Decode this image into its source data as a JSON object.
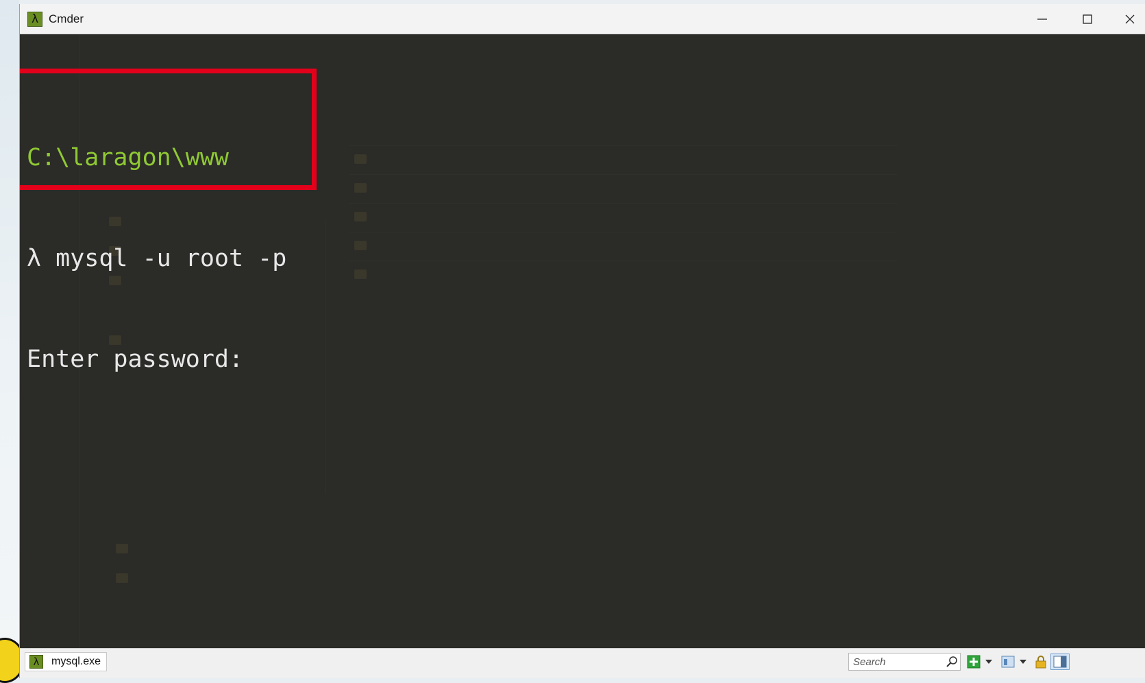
{
  "window": {
    "title": "Cmder",
    "icon": "lambda-icon"
  },
  "titlebar_buttons": {
    "minimize_icon": "minimize-icon",
    "maximize_icon": "maximize-icon",
    "close_icon": "close-icon"
  },
  "console": {
    "path_line": "C:\\laragon\\www",
    "command_line": "λ mysql -u root -p",
    "prompt_line": "Enter password:",
    "path_color": "#8fc933",
    "text_color": "#e8e8e8",
    "highlight_color": "#e3001b"
  },
  "statusbar": {
    "tab_label": "mysql.exe",
    "search_placeholder": "Search",
    "buttons": [
      "new-console-icon",
      "dropdown-arrow-icon",
      "split-view-icon",
      "dropdown-arrow-icon",
      "lock-icon",
      "pane-layout-icon"
    ]
  }
}
